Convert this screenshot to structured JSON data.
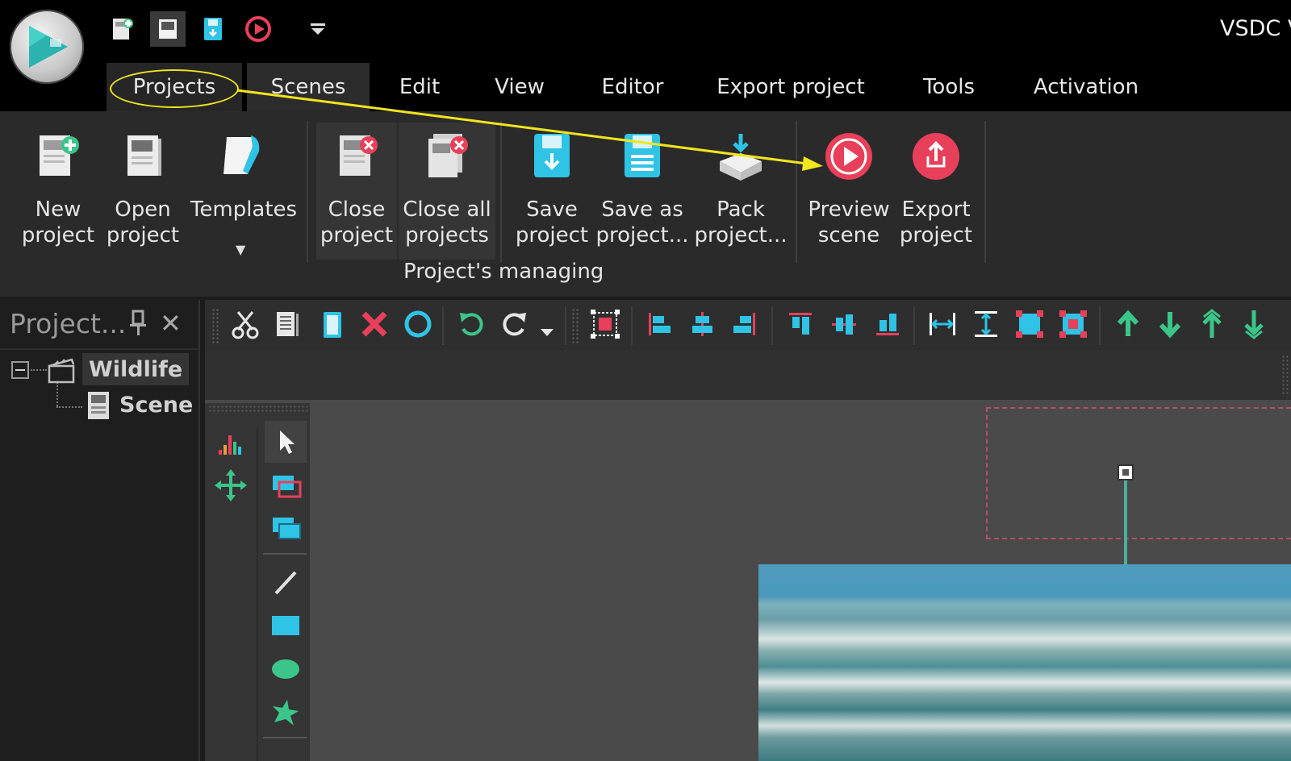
{
  "window": {
    "title": "VSDC V"
  },
  "quick_access": [
    "new-project-icon",
    "window-icon",
    "save-icon",
    "preview-icon",
    "customize-dropdown-icon"
  ],
  "menu": {
    "tabs": [
      "Projects",
      "Scenes",
      "Edit",
      "View",
      "Editor",
      "Export project",
      "Tools",
      "Activation"
    ],
    "active": "Projects"
  },
  "ribbon": {
    "buttons": {
      "new_project": "New\nproject",
      "open_project": "Open\nproject",
      "templates": "Templates",
      "close_project": "Close\nproject",
      "close_all_projects": "Close all\nprojects",
      "save_project": "Save\nproject",
      "save_as_project": "Save as\nproject...",
      "pack_project": "Pack\nproject...",
      "preview_scene": "Preview\nscene",
      "export_project": "Export\nproject"
    },
    "group_label": "Project's managing"
  },
  "explorer": {
    "title": "Project...",
    "close_glyph": "✕",
    "tree": {
      "root": "Wildlife",
      "child": "Scene"
    }
  },
  "colors": {
    "accent_red": "#e8405a",
    "accent_cyan": "#2fc3e6",
    "accent_green": "#3cc58a",
    "annotation_yellow": "#f2e51e"
  },
  "annotation": {
    "highlight": "Projects",
    "points_to": "Preview scene"
  }
}
